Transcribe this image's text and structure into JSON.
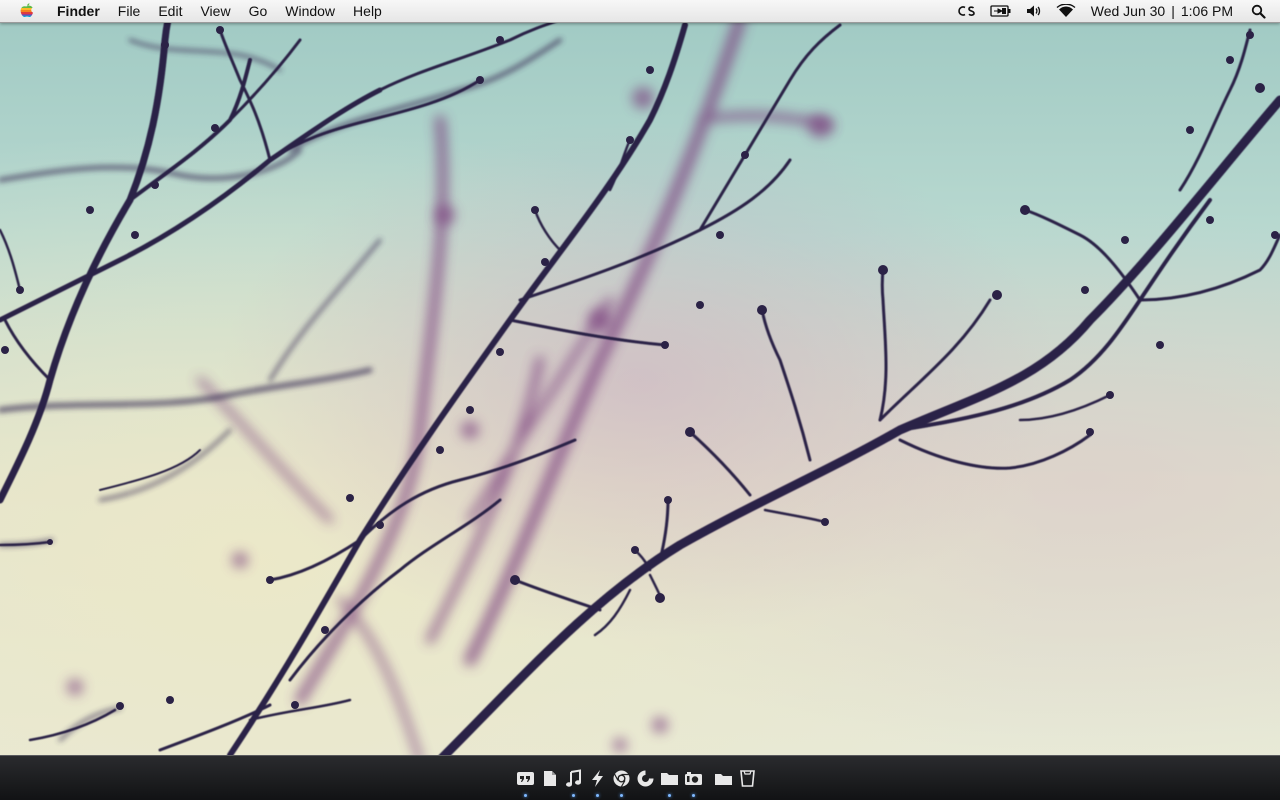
{
  "menubar": {
    "apple_icon": "apple-logo-icon",
    "items": [
      {
        "label": "Finder",
        "bold": true
      },
      {
        "label": "File"
      },
      {
        "label": "Edit"
      },
      {
        "label": "View"
      },
      {
        "label": "Go"
      },
      {
        "label": "Window"
      },
      {
        "label": "Help"
      }
    ],
    "status_icons": [
      "creative-suite-icon",
      "battery-icon",
      "volume-icon",
      "wifi-icon"
    ],
    "clock": {
      "date": "Wed Jun 30",
      "separator": "|",
      "time": "1:06 PM"
    },
    "search_icon": "spotlight-search-icon"
  },
  "dock": {
    "items": [
      {
        "icon": "quote-icon",
        "running": true
      },
      {
        "icon": "document-icon",
        "running": false
      },
      {
        "icon": "music-note-icon",
        "running": true
      },
      {
        "icon": "lightning-icon",
        "running": true
      },
      {
        "icon": "chrome-icon",
        "running": true
      },
      {
        "icon": "refresh-icon",
        "running": false
      },
      {
        "icon": "folder-icon",
        "running": true
      },
      {
        "icon": "camera-icon",
        "running": true
      },
      {
        "icon": "folder-icon",
        "running": false
      },
      {
        "icon": "trash-icon",
        "running": false
      }
    ]
  },
  "wallpaper": {
    "description_icon": "tree-branches-wallpaper"
  }
}
